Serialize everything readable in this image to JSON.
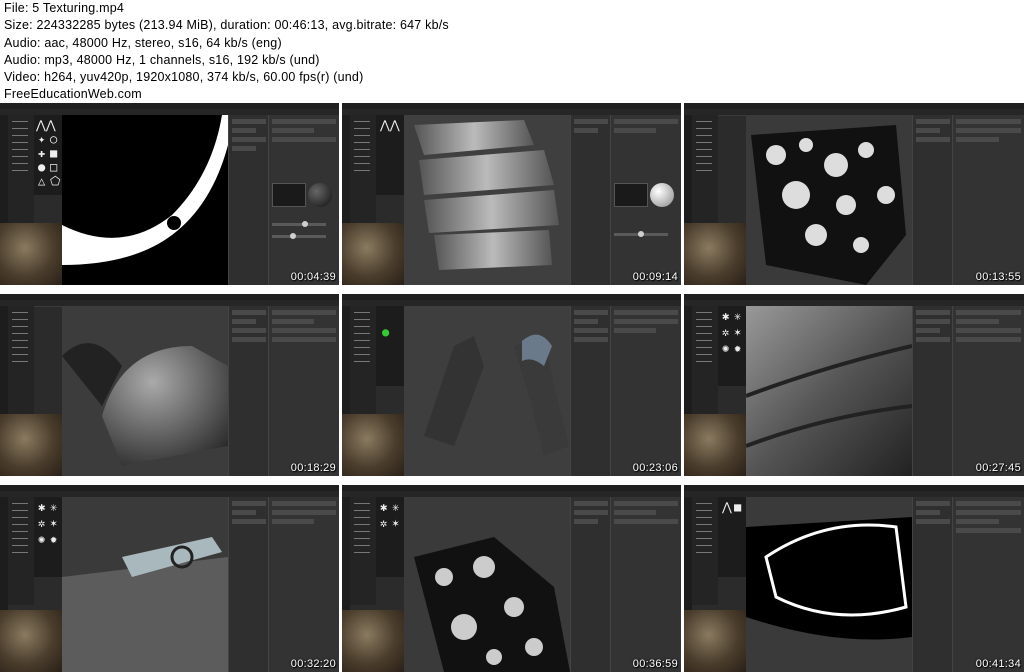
{
  "header": {
    "file": "File: 5 Texturing.mp4",
    "size": "Size: 224332285 bytes (213.94 MiB), duration: 00:46:13, avg.bitrate: 647 kb/s",
    "audio1": "Audio: aac, 48000 Hz, stereo, s16, 64 kb/s (eng)",
    "audio2": "Audio: mp3, 48000 Hz, 1 channels, s16, 192 kb/s (und)",
    "video": "Video: h264, yuv420p, 1920x1080, 374 kb/s, 60.00 fps(r) (und)",
    "site": "FreeEducationWeb.com"
  },
  "thumbnails": [
    {
      "timestamp": "00:04:39",
      "scene": "mask-black-white"
    },
    {
      "timestamp": "00:09:14",
      "scene": "grey-armor-model"
    },
    {
      "timestamp": "00:13:55",
      "scene": "grunge-mask"
    },
    {
      "timestamp": "00:18:29",
      "scene": "metal-pauldron"
    },
    {
      "timestamp": "00:23:06",
      "scene": "arm-armor-pieces"
    },
    {
      "timestamp": "00:27:45",
      "scene": "metal-closeup"
    },
    {
      "timestamp": "00:32:20",
      "scene": "pauldron-strap"
    },
    {
      "timestamp": "00:36:59",
      "scene": "grunge-mask-2"
    },
    {
      "timestamp": "00:41:34",
      "scene": "edge-mask"
    }
  ],
  "colors": {
    "ui_dark": "#2b2b2b",
    "viewport": "#3b3b3b",
    "panel": "#333333",
    "timestamp_text": "#ffffff"
  }
}
